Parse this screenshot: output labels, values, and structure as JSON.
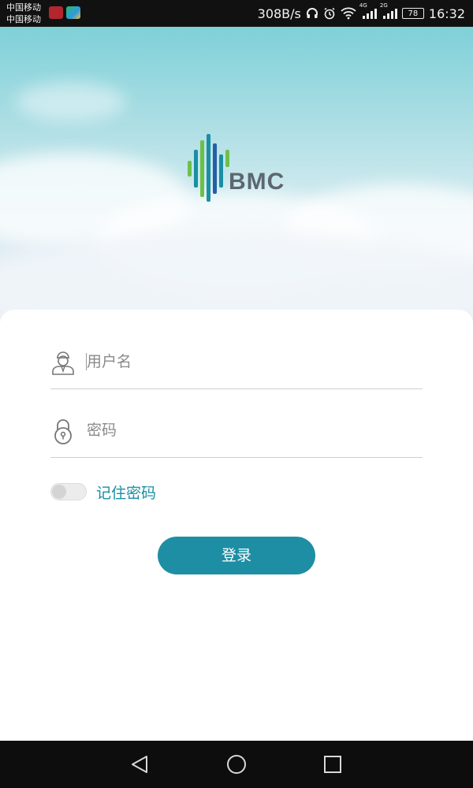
{
  "status_bar": {
    "carrier_1": "中国移动",
    "carrier_2": "中国移动",
    "net_speed": "308B/s",
    "signal_1_tag": "4G",
    "signal_2_tag": "2G",
    "battery": "78",
    "time": "16:32",
    "icons": [
      "huawei-app-icon",
      "google-play-icon",
      "headphones-icon",
      "alarm-icon",
      "wifi-icon",
      "signal-icon",
      "signal-icon",
      "battery-icon"
    ]
  },
  "header": {
    "logo_text": "BMC",
    "logo_colors": [
      "#6cc04a",
      "#1a8fa4",
      "#2460a8"
    ]
  },
  "form": {
    "username": {
      "icon": "user-avatar-icon",
      "placeholder": "用户名",
      "value": ""
    },
    "password": {
      "icon": "lock-icon",
      "placeholder": "密码",
      "value": ""
    },
    "remember": {
      "label": "记住密码",
      "checked": false
    },
    "login_label": "登录"
  },
  "nav_bar": {
    "icons": [
      "back-icon",
      "home-icon",
      "recent-apps-icon"
    ]
  },
  "colors": {
    "accent": "#1e8ea4",
    "remember_text": "#1a8fa4",
    "logo_gray": "#5c6770"
  }
}
